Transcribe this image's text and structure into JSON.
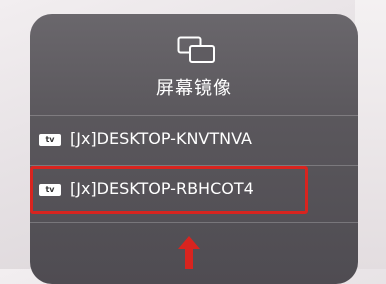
{
  "header": {
    "title": "屏幕镜像",
    "icon": "screen-mirroring-icon"
  },
  "devices": [
    {
      "badge": "tv",
      "name": "[Jx]DESKTOP-KNVTNVA",
      "icon": "apple-tv-icon"
    },
    {
      "badge": "tv",
      "name": "[Jx]DESKTOP-RBHCOT4",
      "icon": "apple-tv-icon",
      "highlighted": true
    }
  ],
  "colors": {
    "panel": "#5a575c",
    "text": "#ffffff",
    "highlight": "#d8241f"
  }
}
